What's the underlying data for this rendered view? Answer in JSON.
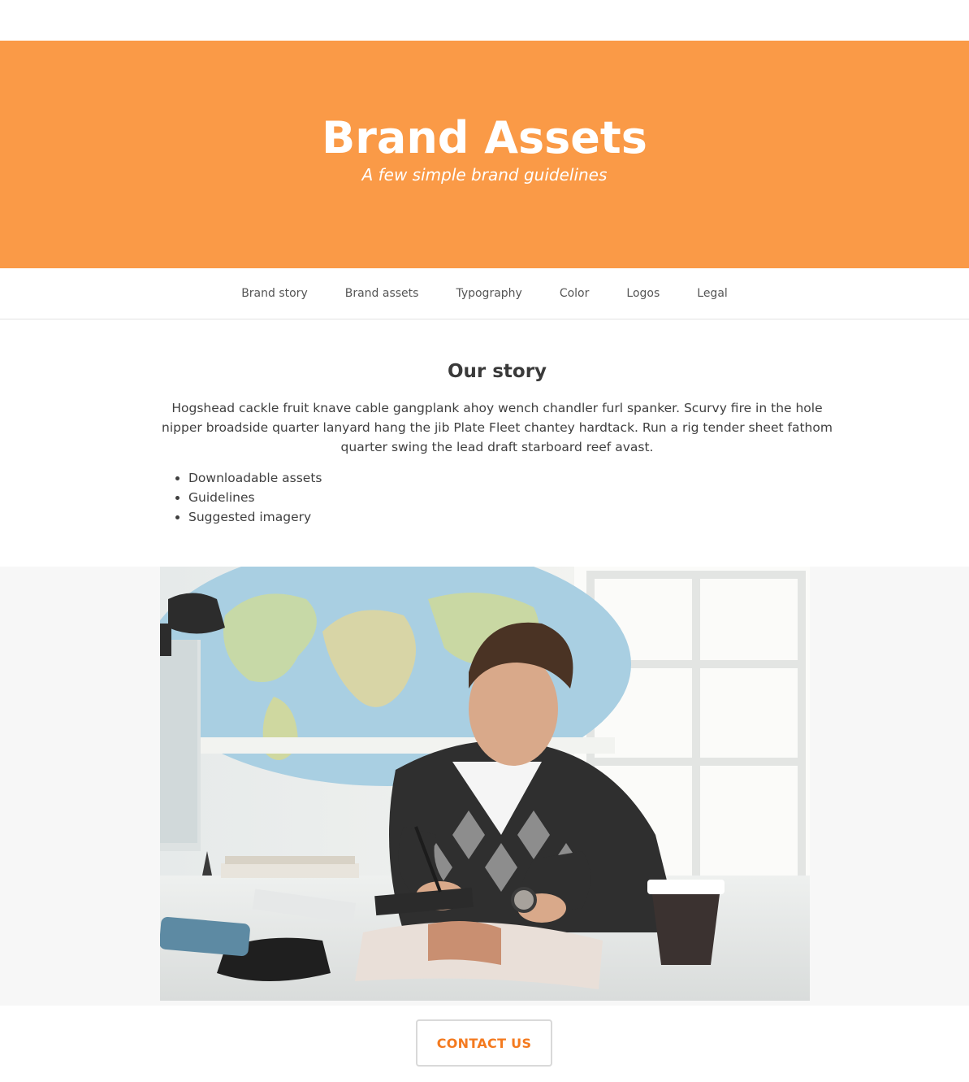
{
  "hero": {
    "title": "Brand Assets",
    "subtitle": "A few simple brand guidelines",
    "background_color": "#fa9a47"
  },
  "nav": {
    "items": [
      {
        "label": "Brand story"
      },
      {
        "label": "Brand assets"
      },
      {
        "label": "Typography"
      },
      {
        "label": "Color"
      },
      {
        "label": "Logos"
      },
      {
        "label": "Legal"
      }
    ]
  },
  "story": {
    "title": "Our story",
    "text": "Hogshead cackle fruit knave cable gangplank ahoy wench chandler furl spanker. Scurvy fire in the hole nipper broadside quarter lanyard hang the jib Plate Fleet chantey hardtack. Run a rig tender sheet fathom quarter swing the lead draft starboard reef avast.",
    "list": [
      "Downloadable assets",
      "Guidelines",
      "Suggested imagery"
    ]
  },
  "photo": {
    "description_icon": "man-writing-at-desk-photo"
  },
  "contact": {
    "label": "CONTACT US",
    "accent_color": "#f47a1f"
  }
}
